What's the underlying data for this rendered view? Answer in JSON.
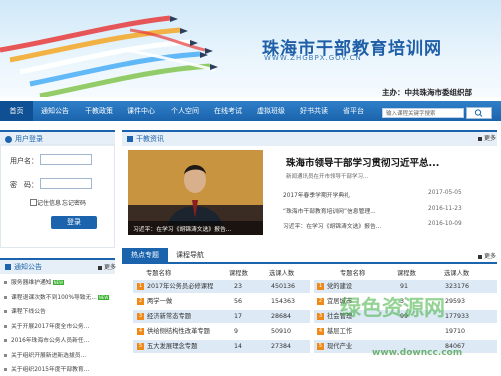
{
  "banner": {
    "title": "珠海市干部教育培训网",
    "url": "WWW.ZHGBPX.GOV.CN",
    "host": "主办：中共珠海市委组织部"
  },
  "nav": {
    "items": [
      "首页",
      "通知公告",
      "干教政策",
      "课件中心",
      "个人空间",
      "在线考试",
      "虚拟班级",
      "好书共读",
      "省平台"
    ],
    "search_placeholder": "输入课程关键字搜索"
  },
  "login": {
    "header": "用户登录",
    "username_label": "用户名：",
    "password_label": "密　码：",
    "remember_label": "记住信息",
    "forgot_label": "忘记密码",
    "submit_label": "登录"
  },
  "notices": {
    "header": "通知公告",
    "more": "更多",
    "items": [
      {
        "text": "服务器维护通知",
        "new": "NEW"
      },
      {
        "text": "课程退课次数不到100%导致无...",
        "new": "NEW"
      },
      {
        "text": "课程下线公告",
        "new": ""
      },
      {
        "text": "关于开展2017年度全市公务...",
        "new": ""
      },
      {
        "text": "2016年珠海市公务人员新任...",
        "new": ""
      },
      {
        "text": "关于组织开展新进新选拔员...",
        "new": ""
      },
      {
        "text": "关于组织2015年度干部教育...",
        "new": ""
      }
    ]
  },
  "news": {
    "header": "干教资讯",
    "more": "更多",
    "caption": "习近平：在学习《胡锦涛文选》报告...",
    "headline": "珠海市领导干部学习贯彻习近平总...",
    "subtitle": "新闻通讯员在开市领导干部学习...",
    "rows": [
      {
        "text": "2017年春季学期开学典礼",
        "date": "2017-05-05"
      },
      {
        "text": "“珠海市干部教育培训网”信息管理...",
        "date": "2016-11-23"
      },
      {
        "text": "习近平：在学习《胡锦涛文选》报告...",
        "date": "2016-10-09"
      }
    ]
  },
  "topics": {
    "tab_hot": "热点专题",
    "tab_guide": "课程导航",
    "more": "更多",
    "headers": [
      "专题名称",
      "课程数",
      "选课人数"
    ],
    "left": [
      {
        "rank": "1",
        "name": "2017年公务员必修课程",
        "courses": "23",
        "learners": "450136"
      },
      {
        "rank": "2",
        "name": "两学一做",
        "courses": "56",
        "learners": "154363"
      },
      {
        "rank": "3",
        "name": "经济新常态专题",
        "courses": "17",
        "learners": "28684"
      },
      {
        "rank": "4",
        "name": "供给侧结构性改革专题",
        "courses": "9",
        "learners": "50910"
      },
      {
        "rank": "5",
        "name": "五大发展理念专题",
        "courses": "14",
        "learners": "27384"
      }
    ],
    "right": [
      {
        "rank": "1",
        "name": "党的建设",
        "courses": "91",
        "learners": "323176"
      },
      {
        "rank": "2",
        "name": "宜居城市",
        "courses": "3",
        "learners": "29593"
      },
      {
        "rank": "3",
        "name": "社会管理",
        "courses": "99",
        "learners": "177933"
      },
      {
        "rank": "4",
        "name": "基层工作",
        "courses": "",
        "learners": "19710"
      },
      {
        "rank": "5",
        "name": "现代产业",
        "courses": "",
        "learners": "84067"
      }
    ]
  },
  "watermark": {
    "brand": "绿色资源网",
    "url": "www.downcc.com"
  },
  "colors": {
    "nav_blue": "#1b64ad",
    "rank_orange": "#ef8a1a",
    "new_badge": "#35b02c"
  }
}
